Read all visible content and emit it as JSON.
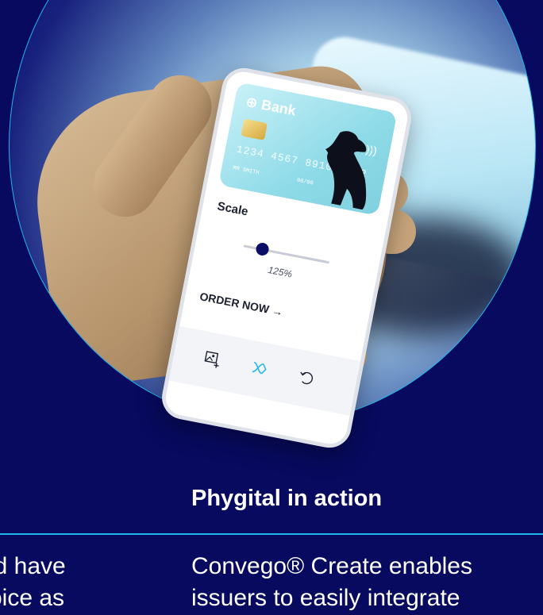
{
  "phone": {
    "card": {
      "bank_name": "Bank",
      "number": "1234 4567 8910 1112",
      "holder": "MR SMITH",
      "expiry": "00/00"
    },
    "scale_label": "Scale",
    "scale_value": "125%",
    "order_button": "ORDER NOW →",
    "toolbar_icons": [
      "add-image-icon",
      "pattern-icon",
      "undo-icon"
    ]
  },
  "section": {
    "title": "Phygital in action",
    "left_text": [
      "ld have",
      "oice as"
    ],
    "right_text": [
      "Convego® Create enables",
      "issuers to easily integrate"
    ]
  },
  "colors": {
    "background": "#070a5e",
    "accent": "#23b6ea",
    "text": "#ffffff"
  }
}
